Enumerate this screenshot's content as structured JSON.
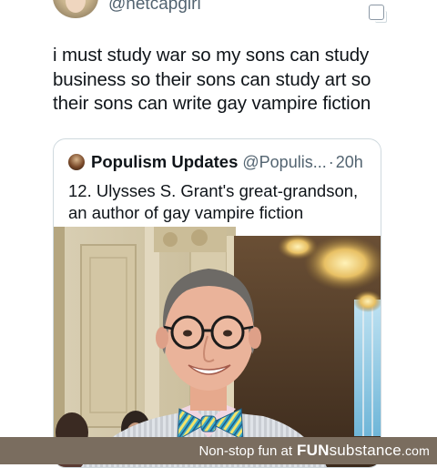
{
  "tweet": {
    "handle": "@netcapgirl",
    "text": "i must study war so my sons can study\nbusiness so their sons can study art so\ntheir sons can write gay vampire fiction",
    "menu_icon": "square-stack-icon"
  },
  "quote": {
    "name": "Populism Updates",
    "handle": "@Populis...",
    "separator": "·",
    "time": "20h",
    "text": "12. Ulysses S. Grant's great-grandson,\nan author of gay vampire fiction",
    "photo_description_icon": "portrait-photo"
  },
  "footer": {
    "tagline": "Non-stop fun at",
    "brand_fun": "FUN",
    "brand_sub": "substance",
    "brand_dom": ".com"
  },
  "colors": {
    "text": "#0f1419",
    "muted": "#536471",
    "border": "#cfd9de",
    "footer_bg": "#7a6d5f"
  }
}
